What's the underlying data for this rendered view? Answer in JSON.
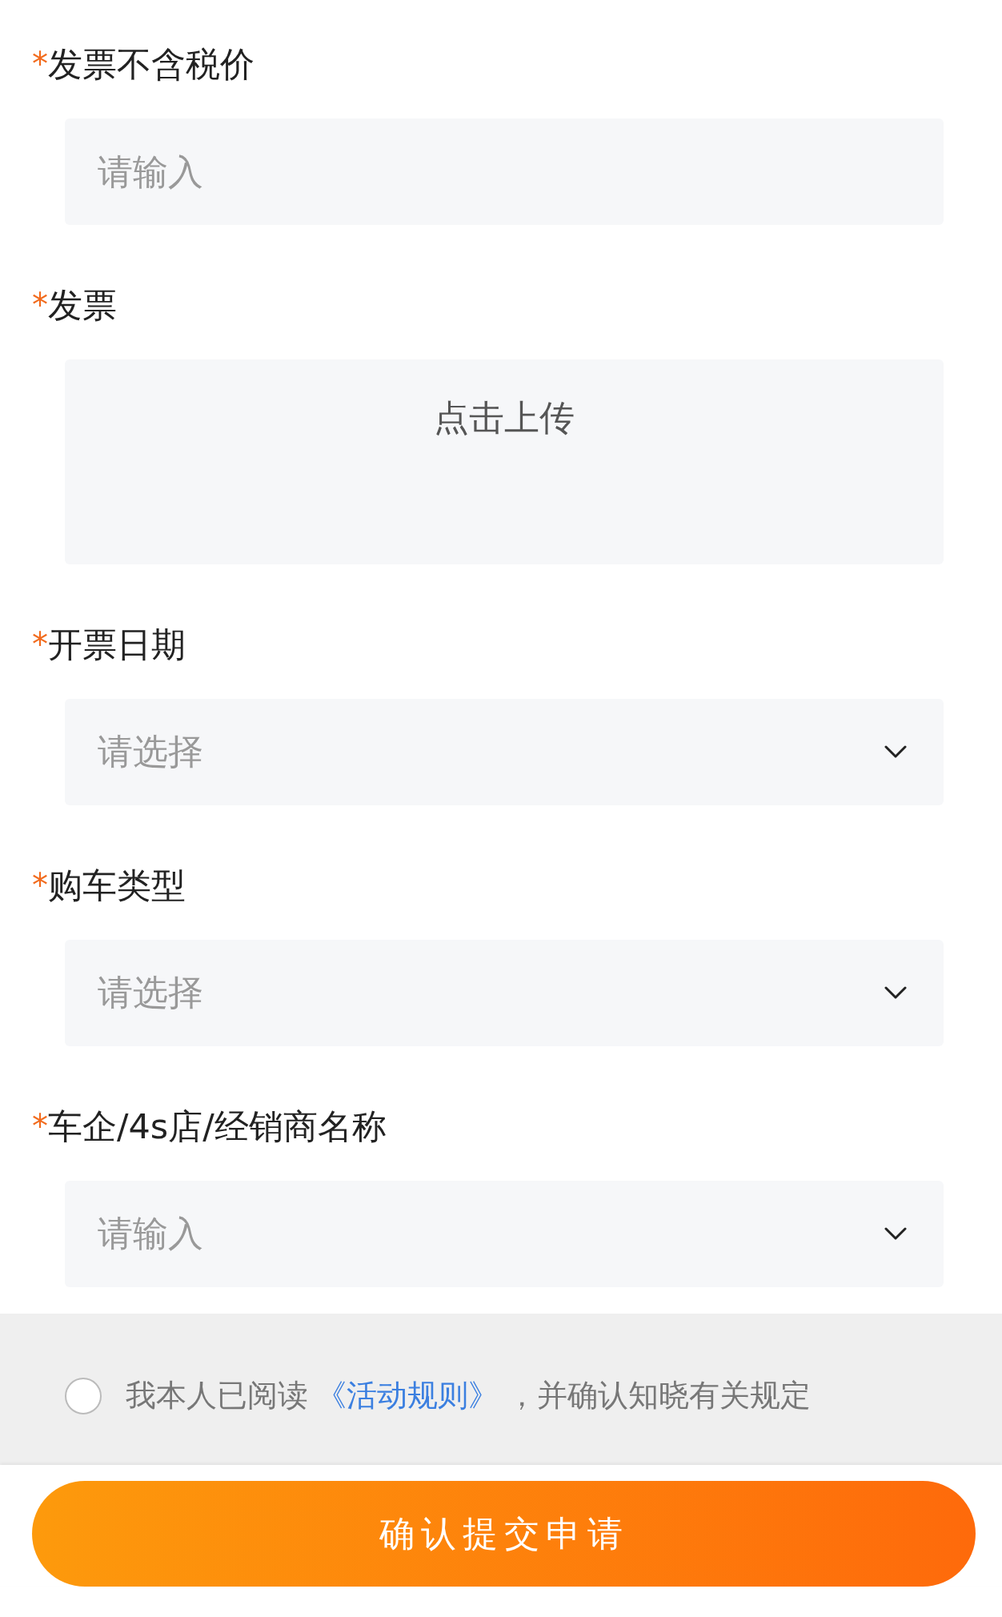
{
  "fields": [
    {
      "mark": "*",
      "label": "发票不含税价",
      "kind": "input",
      "placeholder": "请输入"
    },
    {
      "mark": "*",
      "label": "发票",
      "kind": "upload",
      "button": "点击上传"
    },
    {
      "mark": "*",
      "label": "开票日期",
      "kind": "select",
      "placeholder": "请选择"
    },
    {
      "mark": "*",
      "label": "购车类型",
      "kind": "select",
      "placeholder": "请选择"
    },
    {
      "mark": "*",
      "label": "车企/4s店/经销商名称",
      "kind": "select",
      "placeholder": "请输入"
    }
  ],
  "agreement": {
    "checked": false,
    "before": "我本人已阅读",
    "link": "《活动规则》",
    "after": "，并确认知晓有关规定"
  },
  "submit": "确认提交申请"
}
